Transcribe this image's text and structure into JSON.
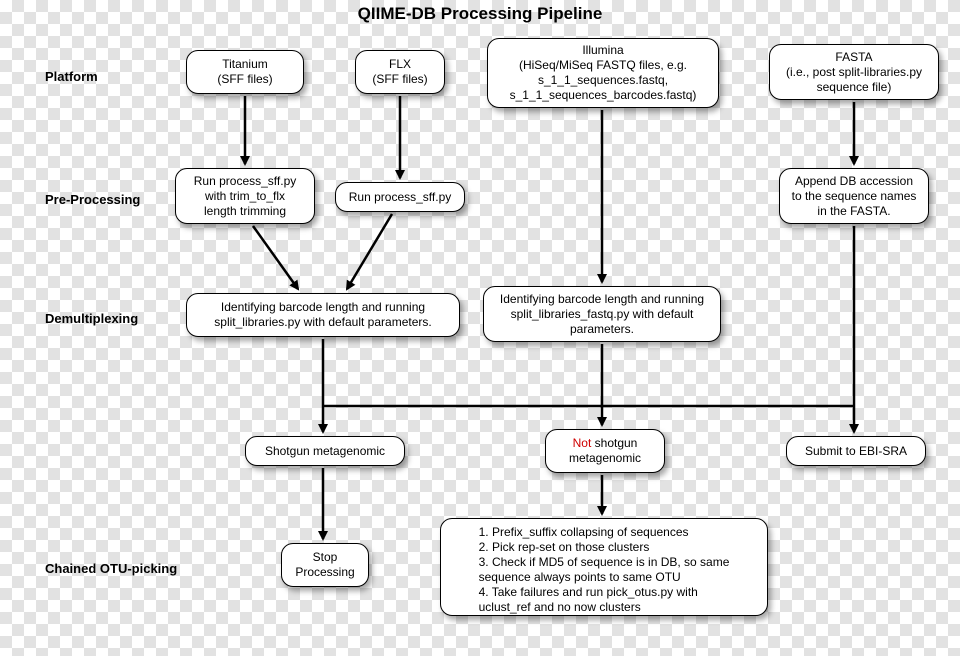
{
  "title": "QIIME-DB Processing Pipeline",
  "row_labels": {
    "platform": "Platform",
    "preproc": "Pre-Processing",
    "demux": "Demultiplexing",
    "chained": "Chained OTU-picking"
  },
  "nodes": {
    "titanium": "Titanium\n(SFF files)",
    "flx": "FLX\n(SFF files)",
    "illumina": "Illumina\n(HiSeq/MiSeq FASTQ files, e.g.\ns_1_1_sequences.fastq,\ns_1_1_sequences_barcodes.fastq)",
    "fasta": "FASTA\n(i.e., post split-libraries.py\nsequence file)",
    "proc_trim": "Run process_sff.py\nwith trim_to_flx\nlength trimming",
    "proc_sff": "Run process_sff.py",
    "append_db": "Append DB accession\nto the sequence names\nin the FASTA.",
    "demux_sff": "Identifying barcode length and running\nsplit_libraries.py with default parameters.",
    "demux_fastq": "Identifying barcode length and running\nsplit_libraries_fastq.py with default\nparameters.",
    "shotgun": "Shotgun metagenomic",
    "not_shotgun_prefix": "Not",
    "not_shotgun_suffix": " shotgun\nmetagenomic",
    "submit_ebi": "Submit to EBI-SRA",
    "stop": "Stop\nProcessing",
    "otu_steps": "1. Prefix_suffix collapsing of sequences\n2. Pick rep-set on those clusters\n3. Check if MD5 of sequence is in DB, so same\nsequence always points to same OTU\n4. Take failures and run pick_otus.py with\nuclust_ref and no now clusters"
  }
}
